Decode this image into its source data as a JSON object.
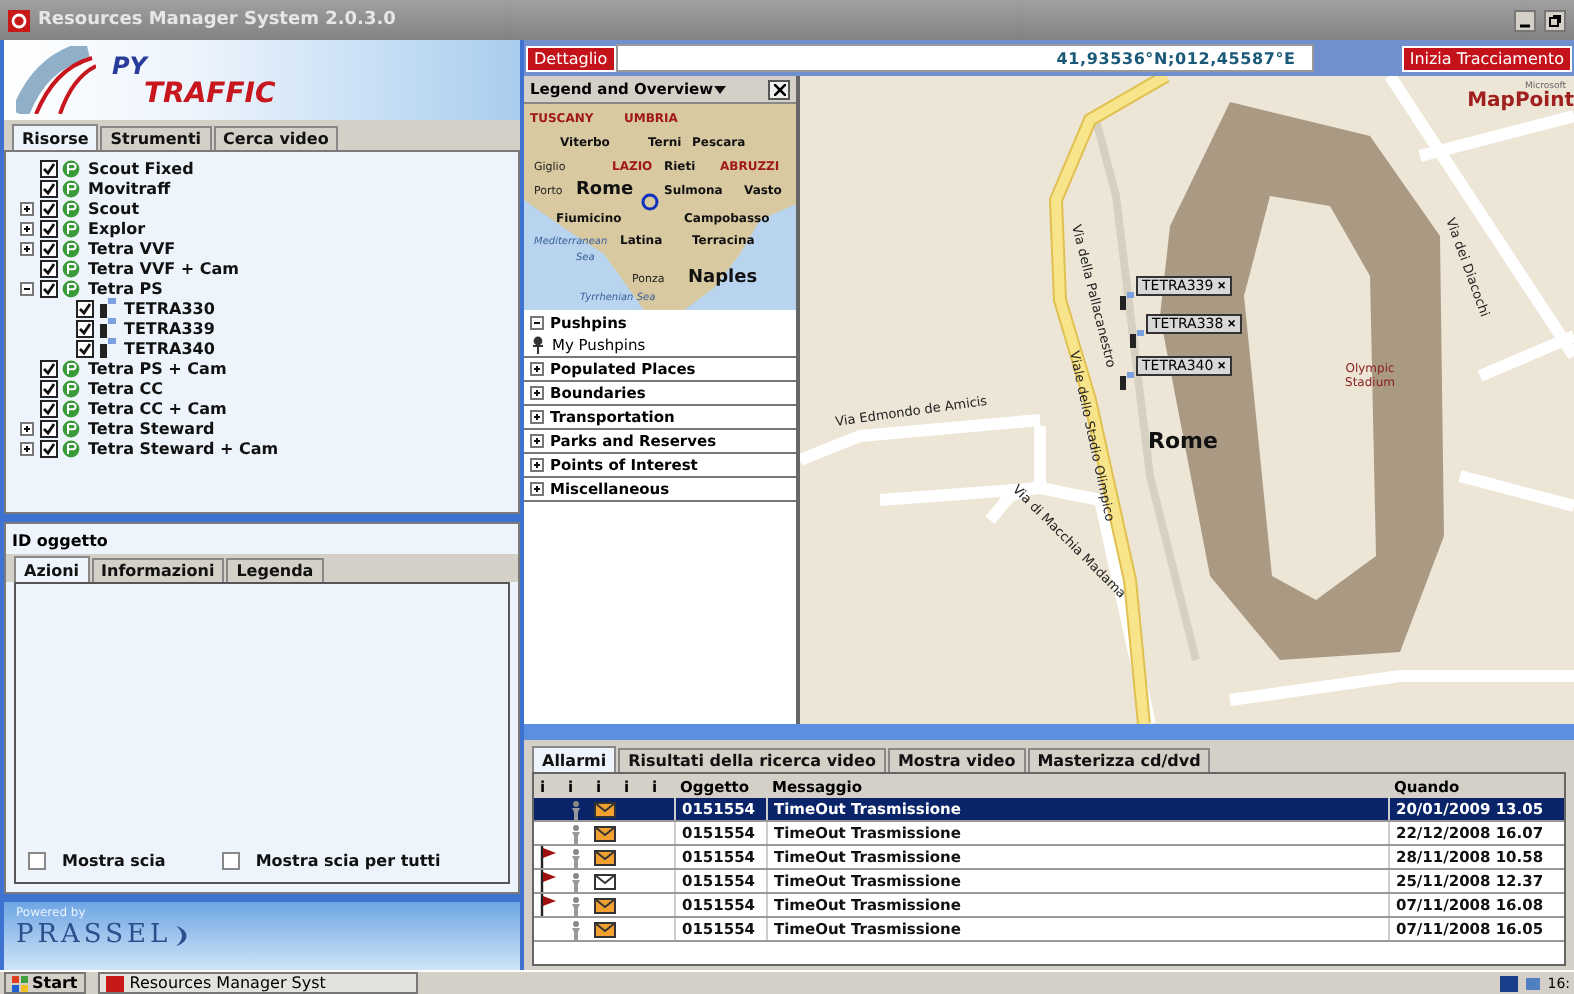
{
  "window": {
    "title": "Resources Manager System 2.0.3.0"
  },
  "logo": {
    "top": "PY",
    "bottom": "TRAFFIC"
  },
  "left_tabs": [
    {
      "label": "Risorse",
      "selected": true
    },
    {
      "label": "Strumenti",
      "selected": false
    },
    {
      "label": "Cerca video",
      "selected": false
    }
  ],
  "tree": [
    {
      "label": "Scout Fixed",
      "kind": "group",
      "checked": true
    },
    {
      "label": "Movitraff",
      "kind": "group",
      "checked": true
    },
    {
      "label": "Scout",
      "kind": "group",
      "checked": true,
      "expanded": false
    },
    {
      "label": "Explor",
      "kind": "group",
      "checked": true,
      "expanded": false
    },
    {
      "label": "Tetra VVF",
      "kind": "group",
      "checked": true,
      "expanded": false
    },
    {
      "label": "Tetra VVF + Cam",
      "kind": "group",
      "checked": true
    },
    {
      "label": "Tetra PS",
      "kind": "group",
      "checked": true,
      "expanded": true,
      "children": [
        {
          "label": "TETRA330",
          "kind": "device",
          "checked": true
        },
        {
          "label": "TETRA339",
          "kind": "device",
          "checked": true
        },
        {
          "label": "TETRA340",
          "kind": "device",
          "checked": true
        }
      ]
    },
    {
      "label": "Tetra PS + Cam",
      "kind": "group",
      "checked": true
    },
    {
      "label": "Tetra CC",
      "kind": "group",
      "checked": true
    },
    {
      "label": "Tetra CC + Cam",
      "kind": "group",
      "checked": true
    },
    {
      "label": "Tetra Steward",
      "kind": "group",
      "checked": true,
      "expanded": false
    },
    {
      "label": "Tetra Steward + Cam",
      "kind": "group",
      "checked": true,
      "expanded": false
    }
  ],
  "object_panel": {
    "title": "ID oggetto",
    "tabs": [
      {
        "label": "Azioni",
        "selected": true
      },
      {
        "label": "Informazioni",
        "selected": false
      },
      {
        "label": "Legenda",
        "selected": false
      }
    ],
    "options": [
      {
        "label": "Mostra scia",
        "checked": false
      },
      {
        "label": "Mostra scia per tutti",
        "checked": false
      }
    ]
  },
  "powered_by": {
    "caption": "Powered by",
    "brand": "PRASSEL"
  },
  "map_toolbar": {
    "detail_label": "Dettaglio",
    "coordinates": "41,93536°N;012,45587°E",
    "tracking_button": "Inizia Tracciamento"
  },
  "legend": {
    "title": "Legend and Overview",
    "overview_labels": [
      {
        "text": "TUSCANY",
        "kind": "region"
      },
      {
        "text": "UMBRIA",
        "kind": "region"
      },
      {
        "text": "Viterbo",
        "kind": "city"
      },
      {
        "text": "Terni",
        "kind": "city"
      },
      {
        "text": "Pescara",
        "kind": "city"
      },
      {
        "text": "Giglio",
        "kind": "town"
      },
      {
        "text": "LAZIO",
        "kind": "region"
      },
      {
        "text": "Rieti",
        "kind": "city"
      },
      {
        "text": "ABRUZZI",
        "kind": "region"
      },
      {
        "text": "Porto",
        "kind": "town"
      },
      {
        "text": "Rome",
        "kind": "capital"
      },
      {
        "text": "Sulmona",
        "kind": "city"
      },
      {
        "text": "Vasto",
        "kind": "city"
      },
      {
        "text": "Fiumicino",
        "kind": "city"
      },
      {
        "text": "Campobasso",
        "kind": "city"
      },
      {
        "text": "Mediterranean",
        "kind": "sea"
      },
      {
        "text": "Latina",
        "kind": "city"
      },
      {
        "text": "Terracina",
        "kind": "city"
      },
      {
        "text": "Sea",
        "kind": "sea"
      },
      {
        "text": "Ponza",
        "kind": "town"
      },
      {
        "text": "Naples",
        "kind": "capital"
      },
      {
        "text": "Tyrrhenian Sea",
        "kind": "sea"
      }
    ],
    "layers": [
      {
        "label": "Pushpins",
        "expanded": true,
        "children": [
          {
            "label": "My Pushpins"
          }
        ]
      },
      {
        "label": "Populated Places",
        "expanded": false
      },
      {
        "label": "Boundaries",
        "expanded": false
      },
      {
        "label": "Transportation",
        "expanded": false
      },
      {
        "label": "Parks and Reserves",
        "expanded": false
      },
      {
        "label": "Points of Interest",
        "expanded": false
      },
      {
        "label": "Miscellaneous",
        "expanded": false
      }
    ]
  },
  "map": {
    "vendor_small": "Microsoft",
    "vendor": "MapPoint",
    "labels": [
      {
        "text": "Via della Pallacanestro",
        "kind": "street"
      },
      {
        "text": "Viale dello Stadio Olimpico",
        "kind": "street"
      },
      {
        "text": "Via Edmondo de Amicis",
        "kind": "street"
      },
      {
        "text": "Via di Macchia Madama",
        "kind": "street"
      },
      {
        "text": "Via dei Diacochi",
        "kind": "street"
      },
      {
        "text": "Rome",
        "kind": "city"
      },
      {
        "text": "Olympic Stadium",
        "kind": "poi"
      }
    ],
    "markers": [
      {
        "label": "TETRA339",
        "close": "×"
      },
      {
        "label": "TETRA338",
        "close": "×"
      },
      {
        "label": "TETRA340",
        "close": "×"
      }
    ]
  },
  "bottom_tabs": [
    {
      "label": "Allarmi",
      "selected": true
    },
    {
      "label": "Risultati della ricerca video",
      "selected": false
    },
    {
      "label": "Mostra video",
      "selected": false
    },
    {
      "label": "Masterizza cd/dvd",
      "selected": false
    }
  ],
  "alarms": {
    "columns": [
      "i",
      "i",
      "i",
      "i",
      "i",
      "Oggetto",
      "Messaggio",
      "Quando"
    ],
    "rows": [
      {
        "flagged": false,
        "read": false,
        "selected": true,
        "object": "0151554",
        "message": "TimeOut Trasmissione",
        "when": "20/01/2009 13.05"
      },
      {
        "flagged": false,
        "read": false,
        "selected": false,
        "object": "0151554",
        "message": "TimeOut Trasmissione",
        "when": "22/12/2008 16.07"
      },
      {
        "flagged": true,
        "read": false,
        "selected": false,
        "object": "0151554",
        "message": "TimeOut Trasmissione",
        "when": "28/11/2008 10.58"
      },
      {
        "flagged": true,
        "read": true,
        "selected": false,
        "object": "0151554",
        "message": "TimeOut Trasmissione",
        "when": "25/11/2008 12.37"
      },
      {
        "flagged": true,
        "read": false,
        "selected": false,
        "object": "0151554",
        "message": "TimeOut Trasmissione",
        "when": "07/11/2008 16.08"
      },
      {
        "flagged": false,
        "read": false,
        "selected": false,
        "object": "0151554",
        "message": "TimeOut Trasmissione",
        "when": "07/11/2008 16.05"
      }
    ]
  },
  "taskbar": {
    "start": "Start",
    "task": "Resources Manager Syst",
    "clock": "16:"
  }
}
